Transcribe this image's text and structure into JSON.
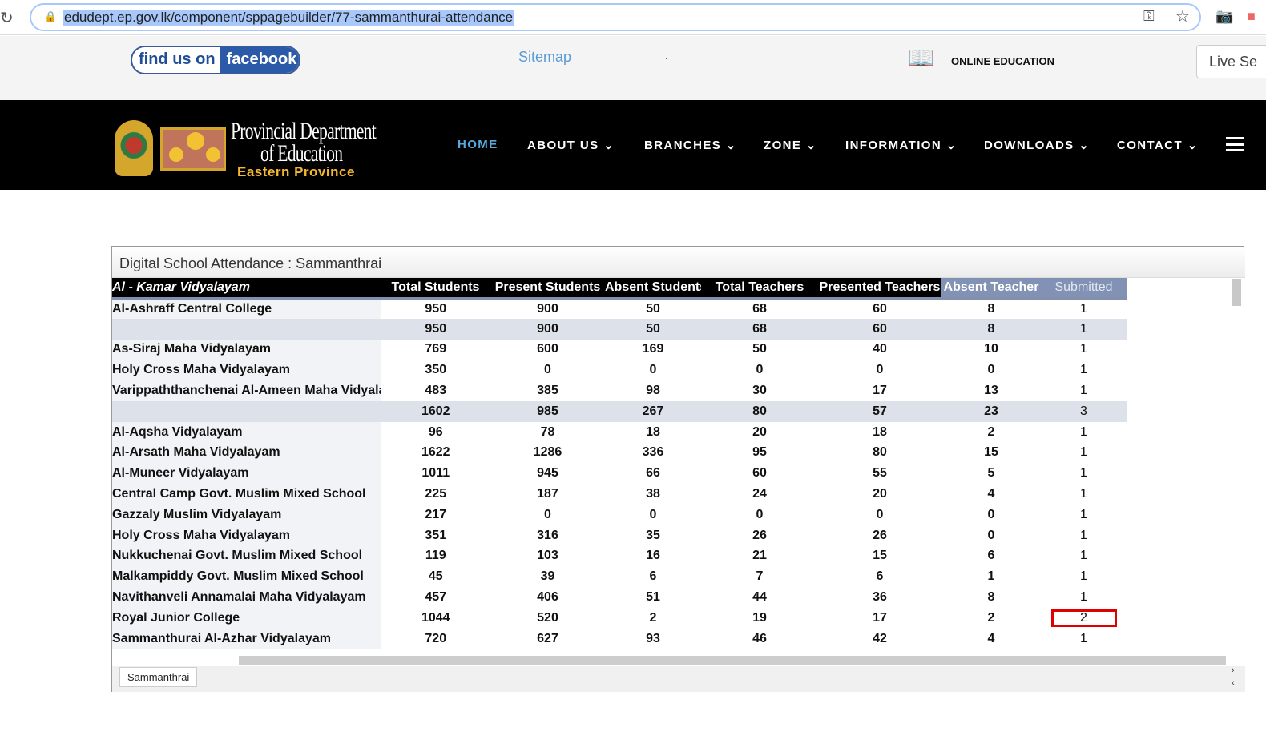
{
  "browser": {
    "url": "edudept.ep.gov.lk/component/sppagebuilder/77-sammanthurai-attendance"
  },
  "topbar": {
    "facebook_a": "find us on",
    "facebook_b": "facebook",
    "sitemap": "Sitemap",
    "dot": ".",
    "online_education": "ONLINE EDUCATION",
    "search_placeholder": "Live Se"
  },
  "header": {
    "logo_line1": "Provincial Department",
    "logo_line2": "of Education",
    "logo_line3": "Eastern Province"
  },
  "nav": [
    {
      "label": "HOME",
      "active": true
    },
    {
      "label": "ABOUT US ⌄"
    },
    {
      "label": "BRANCHES ⌄"
    },
    {
      "label": "ZONE ⌄"
    },
    {
      "label": "INFORMATION ⌄"
    },
    {
      "label": "DOWNLOADS ⌄"
    },
    {
      "label": "CONTACT ⌄"
    }
  ],
  "sheet": {
    "title": "Digital School Attendance : Sammanthrai",
    "columns": [
      "Al - Kamar Vidyalayam",
      "Total Students",
      "Present Students",
      "Absent Students",
      "Total Teachers",
      "Presented Teachers",
      "Absent Teacher",
      "Submitted"
    ],
    "rows": [
      [
        "Al-Ashraff Central College",
        "950",
        "900",
        "50",
        "68",
        "60",
        "8",
        "1"
      ],
      [
        "",
        "950",
        "900",
        "50",
        "68",
        "60",
        "8",
        "1"
      ],
      [
        "As-Siraj Maha Vidyalayam",
        "769",
        "600",
        "169",
        "50",
        "40",
        "10",
        "1"
      ],
      [
        "Holy Cross Maha Vidyalayam",
        "350",
        "0",
        "0",
        "0",
        "0",
        "0",
        "1"
      ],
      [
        "Varippaththanchenai Al-Ameen Maha Vidyalayam",
        "483",
        "385",
        "98",
        "30",
        "17",
        "13",
        "1"
      ],
      [
        "",
        "1602",
        "985",
        "267",
        "80",
        "57",
        "23",
        "3"
      ],
      [
        "Al-Aqsha Vidyalayam",
        "96",
        "78",
        "18",
        "20",
        "18",
        "2",
        "1"
      ],
      [
        "Al-Arsath Maha Vidyalayam",
        "1622",
        "1286",
        "336",
        "95",
        "80",
        "15",
        "1"
      ],
      [
        "Al-Muneer Vidyalayam",
        "1011",
        "945",
        "66",
        "60",
        "55",
        "5",
        "1"
      ],
      [
        "Central Camp Govt. Muslim Mixed School",
        "225",
        "187",
        "38",
        "24",
        "20",
        "4",
        "1"
      ],
      [
        "Gazzaly Muslim Vidyalayam",
        "217",
        "0",
        "0",
        "0",
        "0",
        "0",
        "1"
      ],
      [
        "Holy Cross Maha Vidyalayam",
        "351",
        "316",
        "35",
        "26",
        "26",
        "0",
        "1"
      ],
      [
        "Nukkuchenai Govt. Muslim Mixed School",
        "119",
        "103",
        "16",
        "21",
        "15",
        "6",
        "1"
      ],
      [
        "Malkampiddy Govt. Muslim Mixed School",
        "45",
        "39",
        "6",
        "7",
        "6",
        "1",
        "1"
      ],
      [
        "Navithanveli Annamalai Maha Vidyalayam",
        "457",
        "406",
        "51",
        "44",
        "36",
        "8",
        "1"
      ],
      [
        "Royal Junior College",
        "1044",
        "520",
        "2",
        "19",
        "17",
        "2",
        "2"
      ],
      [
        "Sammanthurai Al-Azhar Vidyalayam",
        "720",
        "627",
        "93",
        "46",
        "42",
        "4",
        "1"
      ]
    ],
    "total_rows": [
      1,
      5
    ],
    "highlight_row": 15,
    "highlight_color": "#e00000",
    "sheet_tab": "Sammanthrai"
  }
}
